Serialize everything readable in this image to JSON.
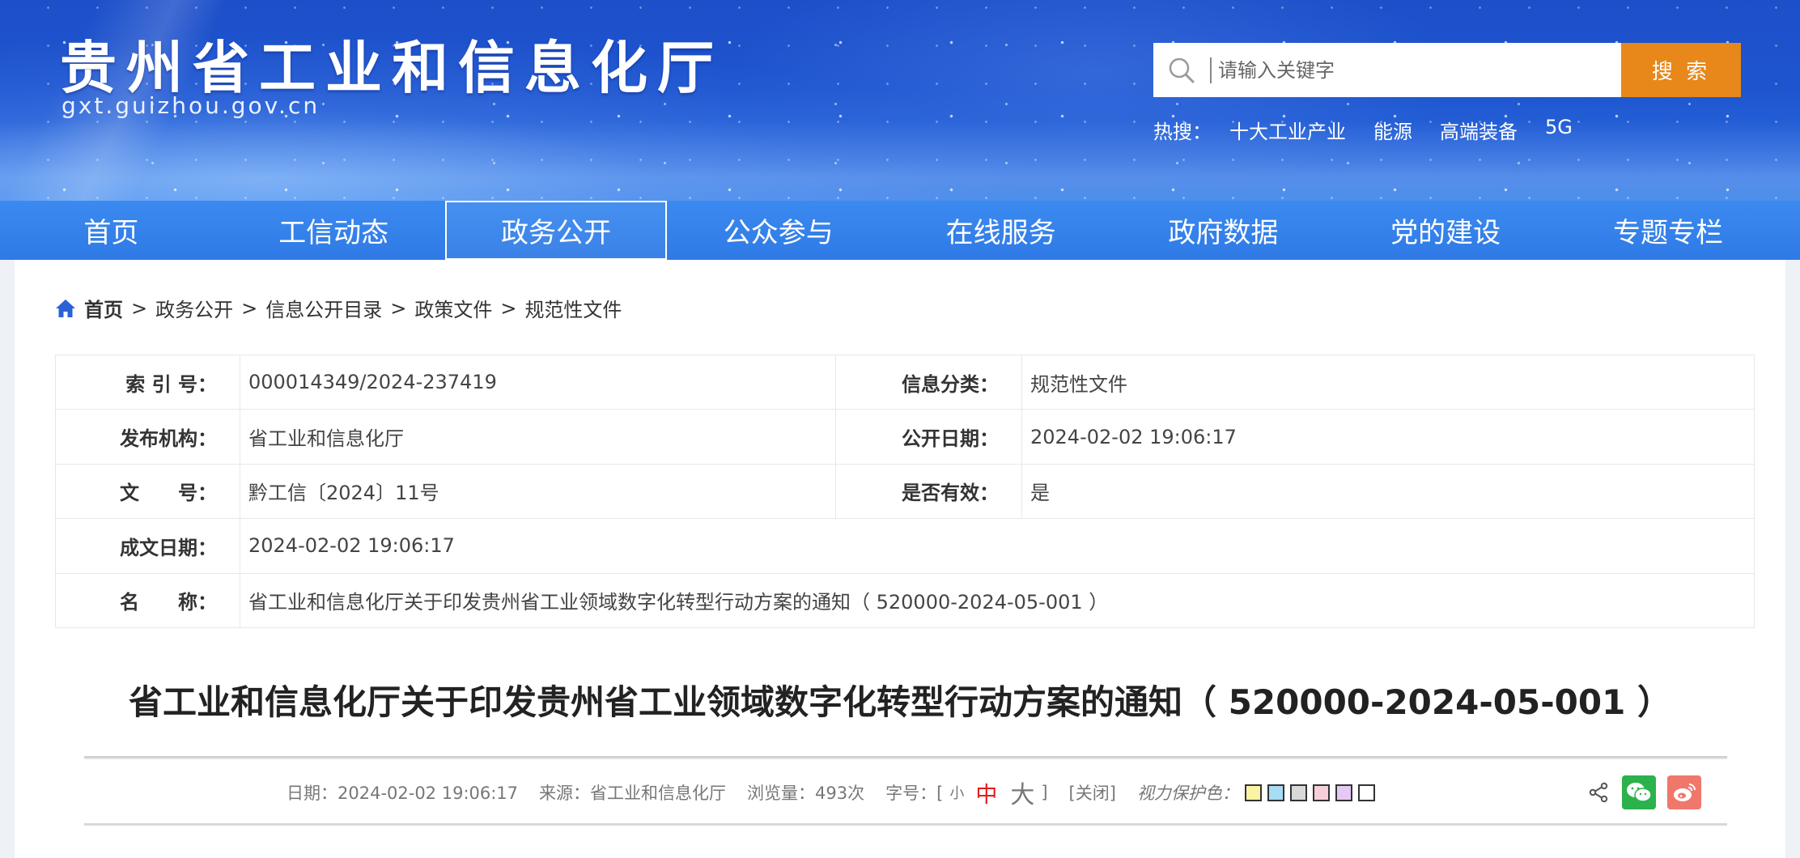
{
  "header": {
    "site_title": "贵州省工业和信息化厅",
    "site_domain": "gxt.guizhou.gov.cn",
    "search": {
      "placeholder": "请输入关键字",
      "button_label": "搜 索"
    },
    "hot": {
      "label": "热搜：",
      "links": [
        "十大工业产业",
        "能源",
        "高端装备",
        "5G"
      ]
    }
  },
  "nav": {
    "items": [
      "首页",
      "工信动态",
      "政务公开",
      "公众参与",
      "在线服务",
      "政府数据",
      "党的建设",
      "专题专栏"
    ],
    "active_index": 2
  },
  "breadcrumb": {
    "home": "首页",
    "separator": ">",
    "items": [
      "政务公开",
      "信息公开目录",
      "政策文件",
      "规范性文件"
    ]
  },
  "info": {
    "index_label": "索 引 号：",
    "index_value": "000014349/2024-237419",
    "category_label": "信息分类：",
    "category_value": "规范性文件",
    "publisher_label": "发布机构：",
    "publisher_value": "省工业和信息化厅",
    "open_date_label": "公开日期：",
    "open_date_value": "2024-02-02 19:06:17",
    "doc_no_label": "文　　号：",
    "doc_no_value": "黔工信〔2024〕11号",
    "valid_label": "是否有效：",
    "valid_value": "是",
    "written_date_label": "成文日期：",
    "written_date_value": "2024-02-02 19:06:17",
    "name_label": "名　　称：",
    "name_value": "省工业和信息化厅关于印发贵州省工业领域数字化转型行动方案的通知（ 520000-2024-05-001 ）"
  },
  "article": {
    "title": "省工业和信息化厅关于印发贵州省工业领域数字化转型行动方案的通知（ 520000-2024-05-001 ）",
    "date": "日期：2024-02-02 19:06:17",
    "source": "来源：省工业和信息化厅",
    "views": "浏览量：493次",
    "font_label": "字号：[",
    "font_small": "小",
    "font_mid": "中",
    "font_big": "大",
    "font_close": "]",
    "close_label": "[关闭]",
    "protect_label": "视力保护色：",
    "swatch_colors": [
      "#f9f3a3",
      "#a8dcf2",
      "#d9d9d9",
      "#f7cfd8",
      "#e6c9f3",
      "#ffffff"
    ]
  },
  "colors": {
    "banner_blue": "#1e55cf",
    "nav_blue": "#2f7ae6",
    "search_orange": "#e8871a",
    "font_mid_red": "#e21a1a",
    "wechat_green": "#2bb24c",
    "weibo_red": "#f0776b"
  },
  "icons": {
    "search": "search-icon",
    "home": "home-icon",
    "share": "share-icon",
    "wechat": "wechat-icon",
    "weibo": "weibo-icon"
  }
}
